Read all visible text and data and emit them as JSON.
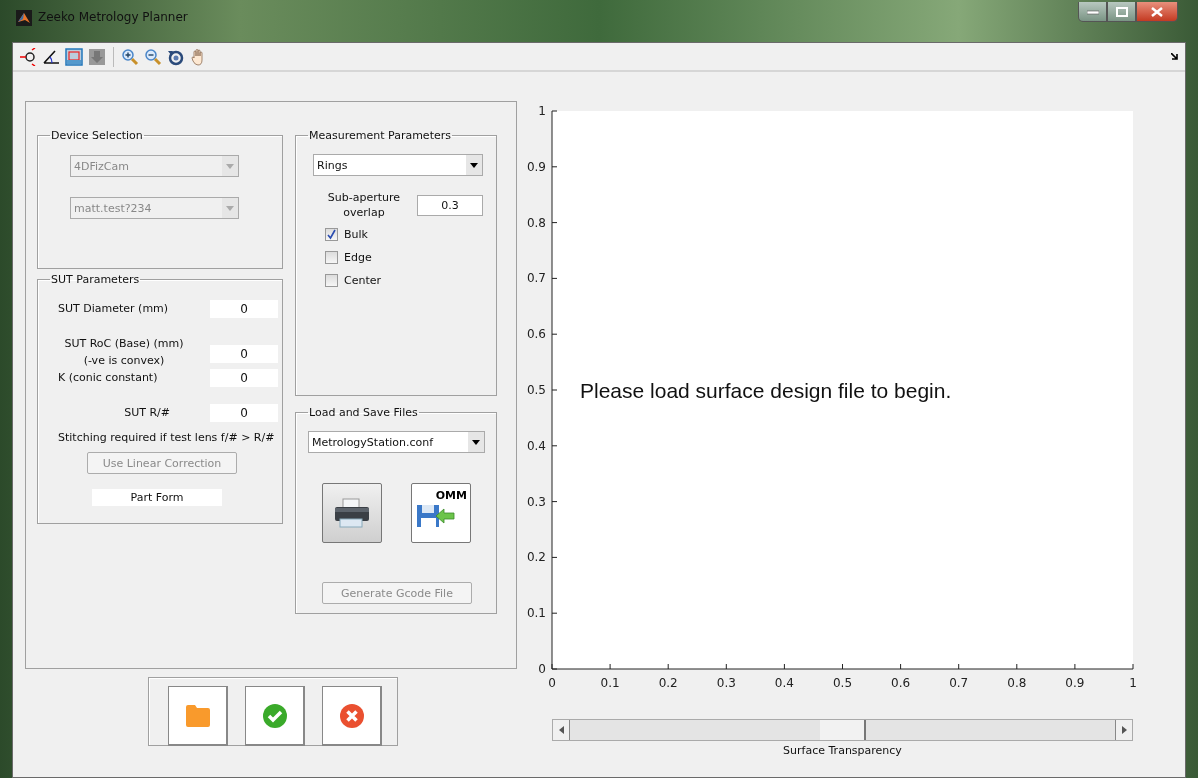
{
  "window": {
    "title": "Zeeko Metrology Planner"
  },
  "device_selection": {
    "title": "Device Selection",
    "dropdowns": [
      {
        "value": "4DFizCam",
        "disabled": true
      },
      {
        "value": "matt.test?234",
        "disabled": true
      }
    ]
  },
  "sut_parameters": {
    "title": "SUT Parameters",
    "fields": [
      {
        "label": "SUT Diameter (mm)",
        "value": "0"
      },
      {
        "label": "SUT RoC (Base) (mm)",
        "sublabel": "(-ve is convex)",
        "value": "0"
      },
      {
        "label": "K (conic constant)",
        "value": "0"
      },
      {
        "label": "SUT R/#",
        "value": "0"
      }
    ],
    "note": "Stitching required if test lens f/# > R/#",
    "correction_button": {
      "label": "Use Linear Correction",
      "disabled": true
    },
    "part_form": "Part Form"
  },
  "measurement_parameters": {
    "title": "Measurement Parameters",
    "mode": "Rings",
    "overlap_label": "Sub-aperture overlap",
    "overlap": "0.3",
    "checkboxes": [
      {
        "label": "Bulk",
        "checked": true
      },
      {
        "label": "Edge",
        "checked": false
      },
      {
        "label": "Center",
        "checked": false
      }
    ]
  },
  "load_save": {
    "title": "Load and Save Files",
    "file": "MetrologyStation.conf",
    "omm_label": "OMM",
    "gcode_button": {
      "label": "Generate Gcode File",
      "disabled": true
    }
  },
  "plot": {
    "message": "Please load surface design file to begin.",
    "chart_data": {
      "type": "line",
      "xlim": [
        0,
        1
      ],
      "ylim": [
        0,
        1
      ],
      "xticks": [
        0,
        0.1,
        0.2,
        0.3,
        0.4,
        0.5,
        0.6,
        0.7,
        0.8,
        0.9,
        1
      ],
      "yticks": [
        0,
        0.1,
        0.2,
        0.3,
        0.4,
        0.5,
        0.6,
        0.7,
        0.8,
        0.9,
        1
      ]
    }
  },
  "transparency": {
    "label": "Surface Transparency",
    "level": 0.5
  }
}
